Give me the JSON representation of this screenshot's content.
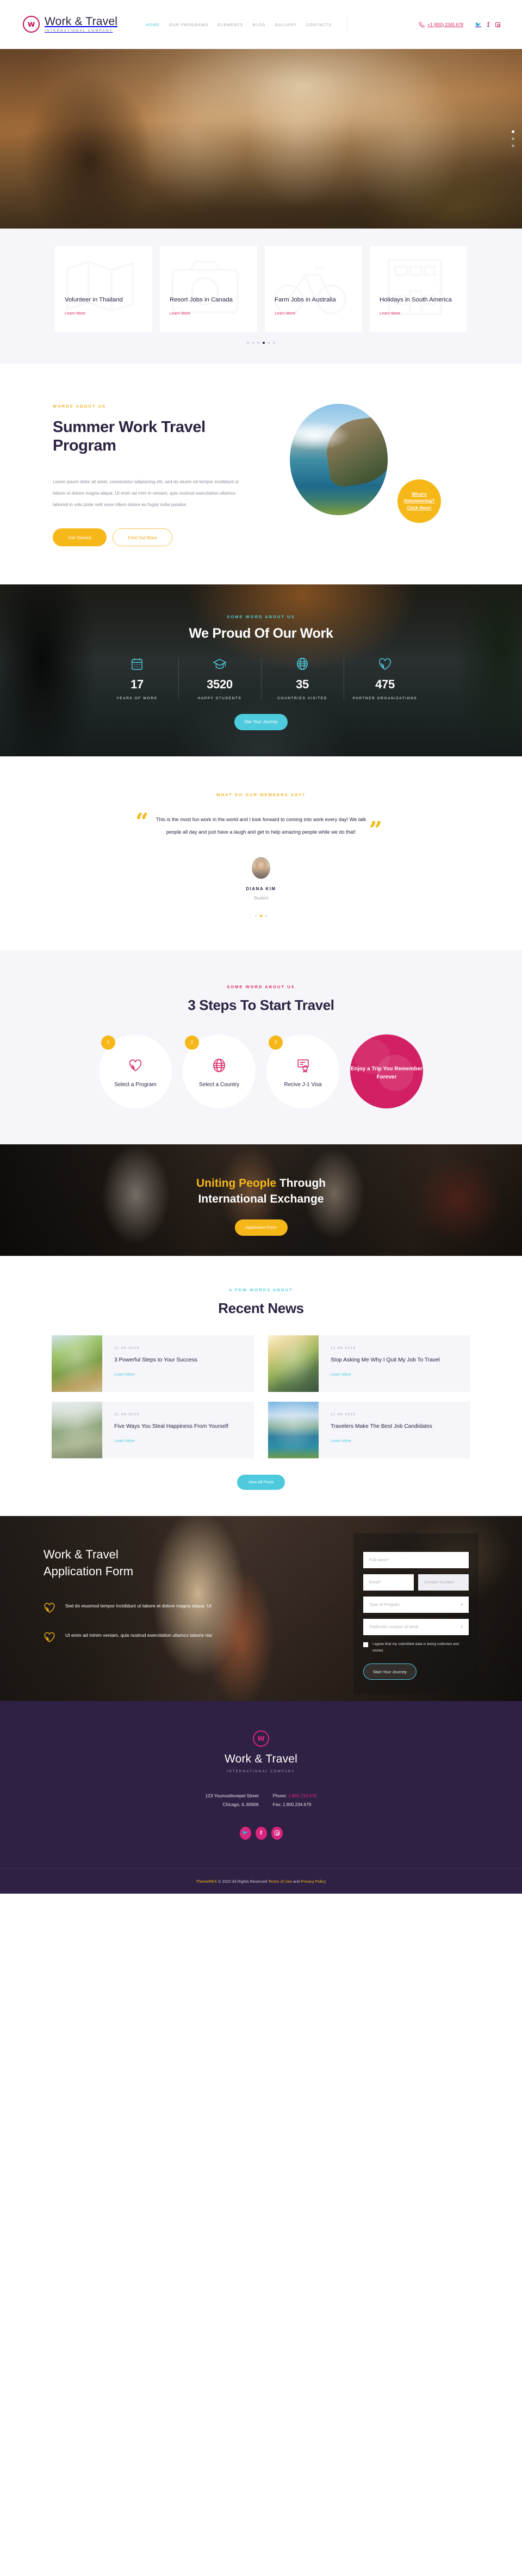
{
  "header": {
    "logo": {
      "name": "Work & Travel",
      "tagline": "INTERNATIONAL COMPANY"
    },
    "nav": [
      {
        "label": "HOME",
        "active": true
      },
      {
        "label": "OUR PROGRAMS",
        "active": false
      },
      {
        "label": "ELEMENTS",
        "active": false
      },
      {
        "label": "BLOG",
        "active": false
      },
      {
        "label": "GALLERY",
        "active": false
      },
      {
        "label": "CONTACTS",
        "active": false
      }
    ],
    "phone": "+1 (800) 2345 678",
    "socials": [
      "twitter-icon",
      "facebook-icon",
      "instagram-icon"
    ]
  },
  "hero": {
    "slide_dots": 3,
    "active_dot": 0
  },
  "programs": {
    "cards": [
      {
        "title": "Volunteer in Thailand",
        "link": "Learn More",
        "icon": "map-icon"
      },
      {
        "title": "Resort Jobs in Canada",
        "link": "Learn More",
        "icon": "camera-icon"
      },
      {
        "title": "Farm Jobs in Australia",
        "link": "Learn More",
        "icon": "bicycle-icon"
      },
      {
        "title": "Holidays in South America",
        "link": "Learn More",
        "icon": "building-icon"
      }
    ],
    "dots": 6,
    "active_dot": 3
  },
  "about": {
    "eyebrow": "WORDS ABOUT US",
    "title": "Summer Work Travel Program",
    "paragraph": "Lorem ipsum dolor sit amet, consectetur adipisicing elit, sed do eiusm od tempor incididunt ut labore et dolore magna aliqua. Ut enim ad mini m veniam, quis nostrud exercitation ullamco laborisli in volu ptate velit esse cillum dolore eu fugiat nulla pariatur.",
    "btn_primary": "Get Started",
    "btn_secondary": "Find Out More",
    "badge": "What's Volunteering? Click Here!"
  },
  "stats": {
    "eyebrow": "SOME WORD ABOUT US",
    "title": "We Proud Of Our Work",
    "items": [
      {
        "value": "17",
        "label": "YEARS OF WORK",
        "icon": "calendar-icon"
      },
      {
        "value": "3520",
        "label": "HAPPY STUDENTS",
        "icon": "graduation-cap-icon"
      },
      {
        "value": "35",
        "label": "COUNTRIES VISITED",
        "icon": "globe-icon"
      },
      {
        "value": "475",
        "label": "PARTNER ORGANIZATIONS",
        "icon": "handshake-heart-icon"
      }
    ],
    "button": "Star Your Journey"
  },
  "testimonial": {
    "eyebrow": "WHAT DO OUR MEMBERS SAY?",
    "quote": "This is the most fun work in the world and I look forward to coming into work every day! We talk people all day and just have a laugh and get to help amazing people while we do that!",
    "author": "DIANA KIM",
    "role": "Student",
    "dots": 3,
    "active_dot": 1
  },
  "steps": {
    "eyebrow": "SOME WORD ABOUT US",
    "title": "3 Steps To Start Travel",
    "items": [
      {
        "num": "1",
        "title": "Select a Program",
        "icon": "handshake-heart-icon"
      },
      {
        "num": "2",
        "title": "Select a Country",
        "icon": "globe-icon"
      },
      {
        "num": "3",
        "title": "Recive J-1 Visa",
        "icon": "certificate-icon"
      }
    ],
    "final": "Enjoy a Trip You Remember Forever"
  },
  "uniting": {
    "title_highlight": "Uniting People",
    "title_rest": " Through",
    "title_line2": "International Exchange",
    "button": "Application Form"
  },
  "news": {
    "eyebrow": "A FEW WORDS ABOUT",
    "title": "Recent News",
    "posts": [
      {
        "date": "11.08.2015",
        "title": "3 Powerful Steps to Your Success",
        "link": "Learn More"
      },
      {
        "date": "11.08.2015",
        "title": "Stop Asking Me Why I Quit My Job To Travel",
        "link": "Learn More"
      },
      {
        "date": "11.08.2015",
        "title": "Five Ways You Steal Happiness From Yourself",
        "link": "Learn More"
      },
      {
        "date": "11.08.2015",
        "title": "Travelers Make The Best Job Candidates",
        "link": "Learn More"
      }
    ],
    "button": "View All Posts"
  },
  "appform": {
    "title_line1": "Work & Travel",
    "title_line2": "Application Form",
    "features": [
      {
        "icon": "handshake-heart-icon",
        "text": "Sed do eiusmod tempor incididunt ut labore et dolore magna aliqua. Ut"
      },
      {
        "icon": "handshake-heart-icon",
        "text": "Ut enim ad minim veniam, quis nostrud exercitation ullamco laboris nisi"
      }
    ],
    "fields": {
      "fullname": "Full name*",
      "email": "Email*",
      "contact": "Contact Number",
      "program": "Type of Program",
      "location": "Preferred Location of Work"
    },
    "agree": "I agree that my submitted data is being collected and stored.",
    "submit": "Start Your Journey"
  },
  "footer": {
    "logo": {
      "name": "Work & Travel",
      "tagline": "INTERNATIONAL COMPANY"
    },
    "address_line1": "123 Youmustlovepet Street",
    "address_line2": "Chicago, IL 60606",
    "phone_label": "Phone:",
    "phone_value": "1.800.234.678",
    "fax": "Fax: 1.800.234.679",
    "socials": [
      "twitter-icon",
      "facebook-icon",
      "instagram-icon"
    ],
    "copyright_brand": "ThemeREX",
    "copyright_mid": " © 2022 All Rights Reserved ",
    "terms": "Terms of Use",
    "and": " and ",
    "privacy": "Privacy Policy"
  },
  "colors": {
    "pink": "#dd2a62",
    "magenta": "#d31f63",
    "yellow": "#f6b719",
    "cyan": "#4ecadd",
    "dark_purple": "#2d2240",
    "footer_bg": "#2f2143",
    "light_bg": "#f5f5fa"
  }
}
